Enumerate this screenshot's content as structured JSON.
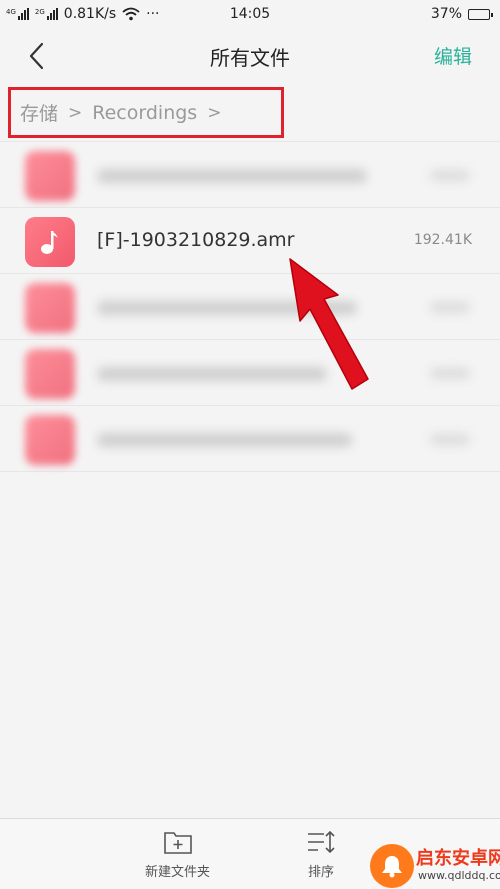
{
  "status_bar": {
    "net_type_1": "4G",
    "net_type_2": "2G",
    "speed": "0.81K/s",
    "more": "···",
    "time": "14:05",
    "battery": "37%",
    "battery_level": 0.37
  },
  "header": {
    "title": "所有文件",
    "edit_label": "编辑"
  },
  "breadcrumb": {
    "items": [
      "存储",
      "Recordings"
    ],
    "separator": ">"
  },
  "files": [
    {
      "name": "",
      "size": "",
      "blurred": true
    },
    {
      "name": "[F]-1903210829.amr",
      "size": "192.41K",
      "blurred": false
    },
    {
      "name": "",
      "size": "",
      "blurred": true
    },
    {
      "name": "",
      "size": "",
      "blurred": true
    },
    {
      "name": "",
      "size": "",
      "blurred": true
    }
  ],
  "bottom_bar": {
    "new_folder_label": "新建文件夹",
    "sort_label": "排序"
  },
  "watermark": {
    "brand": "启东安卓网",
    "url": "www.qdlddq.com"
  },
  "colors": {
    "accent": "#2bb39a",
    "highlight_box": "#e0212e",
    "file_icon": "#f15a6c",
    "arrow": "#e0111e"
  }
}
